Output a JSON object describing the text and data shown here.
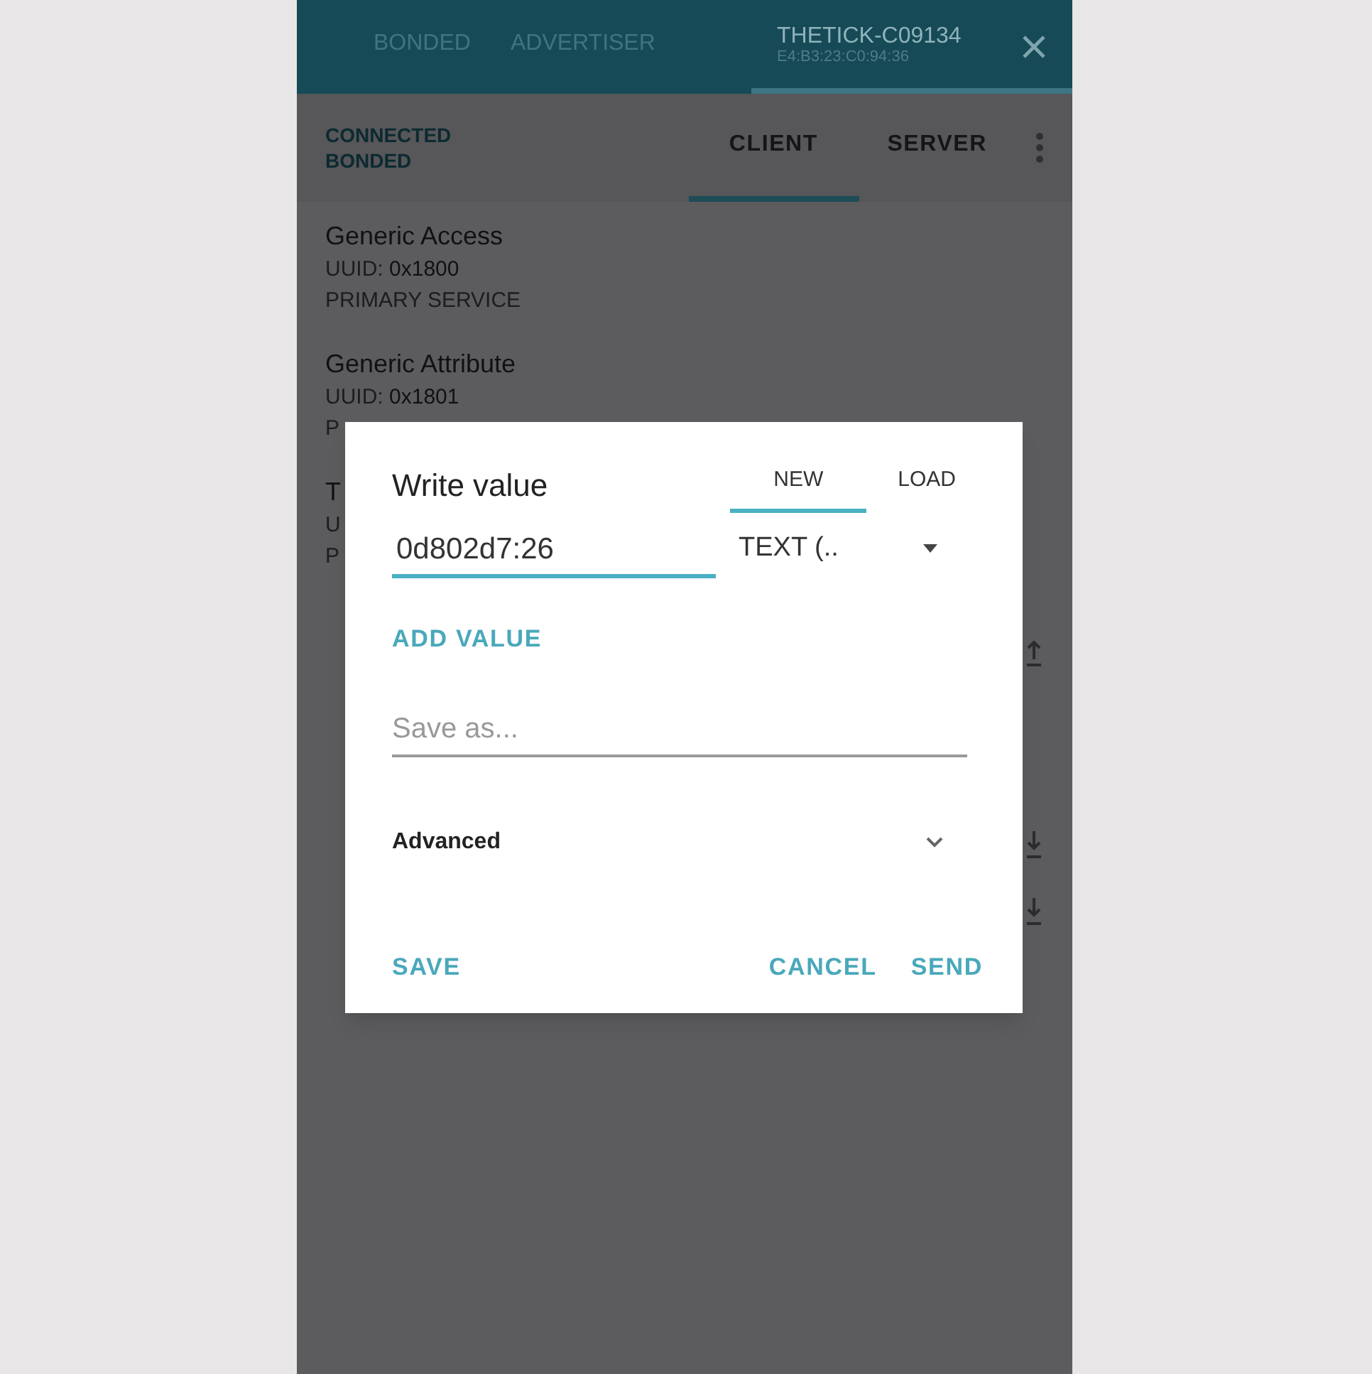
{
  "top_tabs": [
    {
      "label": "BONDED",
      "selected": false
    },
    {
      "label": "ADVERTISER",
      "selected": false
    },
    {
      "label": "THETICK-C09134",
      "subtitle": "E4:B3:23:C0:94:36",
      "selected": true
    }
  ],
  "connection": {
    "state": "CONNECTED",
    "bond": "BONDED"
  },
  "view_tabs": [
    {
      "label": "CLIENT",
      "selected": true
    },
    {
      "label": "SERVER",
      "selected": false
    }
  ],
  "services": [
    {
      "name": "Generic Access",
      "uuid_label": "UUID:",
      "uuid": "0x1800",
      "type": "PRIMARY SERVICE"
    },
    {
      "name": "Generic Attribute",
      "uuid_label": "UUID:",
      "uuid": "0x1801",
      "type": "P"
    },
    {
      "name": "T",
      "uuid_label": "U",
      "type": "P"
    }
  ],
  "dialog": {
    "title": "Write value",
    "tabs": [
      {
        "label": "NEW",
        "selected": true
      },
      {
        "label": "LOAD",
        "selected": false
      }
    ],
    "value": "0d802d7:26",
    "format": "TEXT (..",
    "add_value": "ADD VALUE",
    "save_as_placeholder": "Save as...",
    "advanced": {
      "label": "Advanced",
      "expanded": false
    },
    "buttons": [
      {
        "label": "SAVE",
        "kind": "left"
      },
      {
        "label": "CANCEL",
        "kind": "right"
      },
      {
        "label": "SEND",
        "kind": "right"
      }
    ]
  }
}
